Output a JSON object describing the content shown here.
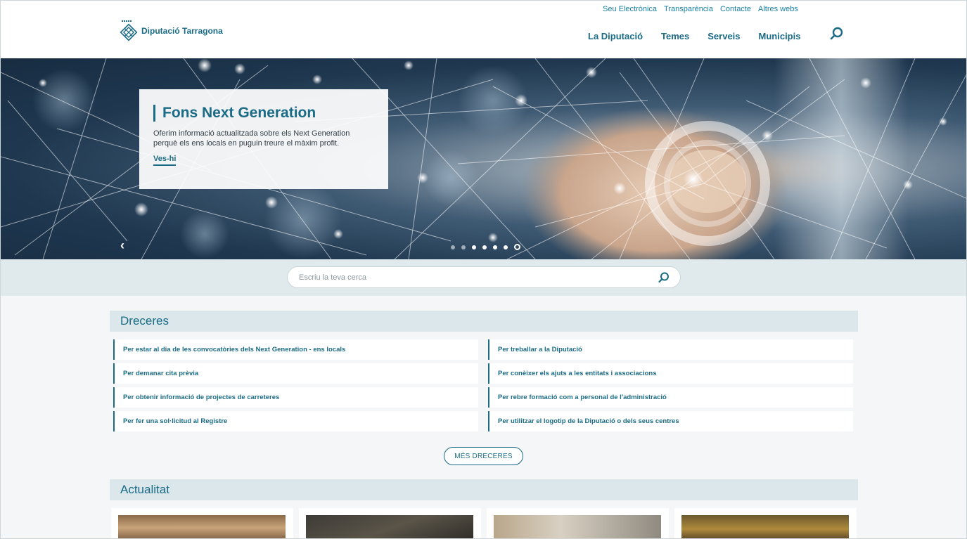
{
  "header": {
    "utility_links": [
      "Seu Electrònica",
      "Transparència",
      "Contacte",
      "Altres webs"
    ],
    "logo_text": "Diputació Tarragona",
    "nav": [
      "La Diputació",
      "Temes",
      "Serveis",
      "Municipis"
    ]
  },
  "hero": {
    "title": "Fons Next Generation",
    "description": "Oferim informació actualitzada sobre els Next Generation perquè els ens locals en puguin treure el màxim profit.",
    "link": "Ves-hi",
    "slide_count": 7,
    "active_slide": 7
  },
  "search": {
    "placeholder": "Escriu la teva cerca"
  },
  "shortcuts": {
    "title": "Dreceres",
    "items": [
      "Per estar al dia de les convocatòries dels Next Generation - ens locals",
      "Per treballar a la Diputació",
      "Per demanar cita prèvia",
      "Per conèixer els ajuts a les entitats i associacions",
      "Per obtenir informació de projectes de carreteres",
      "Per rebre formació com a personal de l'administració",
      "Per fer una sol·licitud al Registre",
      "Per utilitzar el logotip de la Diputació o dels seus centres"
    ],
    "more_label": "MÉS DRECERES"
  },
  "news": {
    "title": "Actualitat"
  },
  "colors": {
    "primary": "#1a6b86",
    "band": "#e0eaed",
    "section_head": "#dbe7ea"
  },
  "icons": [
    "search-icon",
    "chevron-left-icon",
    "diputacio-logo-icon"
  ]
}
